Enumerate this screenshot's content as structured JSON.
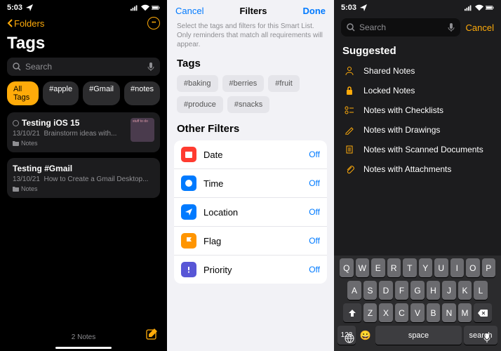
{
  "statusTime": "5:03",
  "panel1": {
    "back": "Folders",
    "title": "Tags",
    "searchPlaceholder": "Search",
    "tags": [
      "All Tags",
      "#apple",
      "#Gmail",
      "#notes"
    ],
    "notes": [
      {
        "title": "Testing iOS 15",
        "date": "13/10/21",
        "preview": "Brainstorm ideas with...",
        "folder": "Notes",
        "thumb": "stuff to do"
      },
      {
        "title": "Testing #Gmail",
        "date": "13/10/21",
        "preview": "How to Create a Gmail Desktop...",
        "folder": "Notes"
      }
    ],
    "count": "2 Notes"
  },
  "panel2": {
    "cancel": "Cancel",
    "title": "Filters",
    "done": "Done",
    "help": "Select the tags and filters for this Smart List. Only reminders that match all requirements will appear.",
    "tagsHeader": "Tags",
    "tags": [
      "#baking",
      "#berries",
      "#fruit",
      "#produce",
      "#snacks"
    ],
    "otherHeader": "Other Filters",
    "filters": [
      {
        "label": "Date",
        "value": "Off",
        "color": "#ff3b30",
        "icon": "cal"
      },
      {
        "label": "Time",
        "value": "Off",
        "color": "#007aff",
        "icon": "clock"
      },
      {
        "label": "Location",
        "value": "Off",
        "color": "#007aff",
        "icon": "loc"
      },
      {
        "label": "Flag",
        "value": "Off",
        "color": "#ff9500",
        "icon": "flag"
      },
      {
        "label": "Priority",
        "value": "Off",
        "color": "#5856d6",
        "icon": "pri"
      }
    ]
  },
  "panel3": {
    "searchPlaceholder": "Search",
    "cancel": "Cancel",
    "suggestedHeader": "Suggested",
    "items": [
      {
        "icon": "shared",
        "label": "Shared Notes"
      },
      {
        "icon": "lock",
        "label": "Locked Notes"
      },
      {
        "icon": "check",
        "label": "Notes with Checklists"
      },
      {
        "icon": "draw",
        "label": "Notes with Drawings"
      },
      {
        "icon": "scan",
        "label": "Notes with Scanned Documents"
      },
      {
        "icon": "attach",
        "label": "Notes with Attachments"
      }
    ],
    "keyboard": {
      "r1": [
        "Q",
        "W",
        "E",
        "R",
        "T",
        "Y",
        "U",
        "I",
        "O",
        "P"
      ],
      "r2": [
        "A",
        "S",
        "D",
        "F",
        "G",
        "H",
        "J",
        "K",
        "L"
      ],
      "r3": [
        "Z",
        "X",
        "C",
        "V",
        "B",
        "N",
        "M"
      ],
      "num": "123",
      "space": "space",
      "ret": "search"
    }
  }
}
